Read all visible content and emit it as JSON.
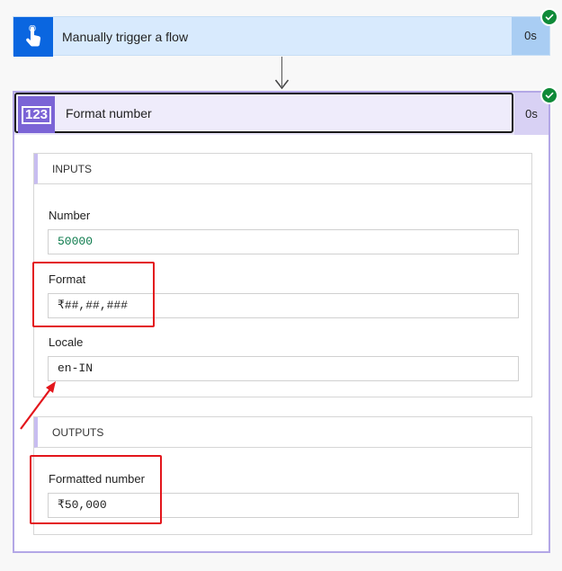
{
  "trigger": {
    "title": "Manually trigger a flow",
    "duration": "0s",
    "icon": "touch-hand-icon",
    "status": "succeeded"
  },
  "action": {
    "icon_label": "123",
    "title": "Format number",
    "duration": "0s",
    "status": "succeeded",
    "inputs": {
      "header": "INPUTS",
      "number_label": "Number",
      "number_value": "50000",
      "format_label": "Format",
      "format_value": "₹##,##,###",
      "locale_label": "Locale",
      "locale_value": "en-IN"
    },
    "outputs": {
      "header": "OUTPUTS",
      "formatted_label": "Formatted number",
      "formatted_value": "₹50,000"
    }
  },
  "colors": {
    "trigger_accent": "#0a66e0",
    "action_accent": "#7b64d6",
    "success": "#0f8a38",
    "annotation": "#e3161c"
  }
}
